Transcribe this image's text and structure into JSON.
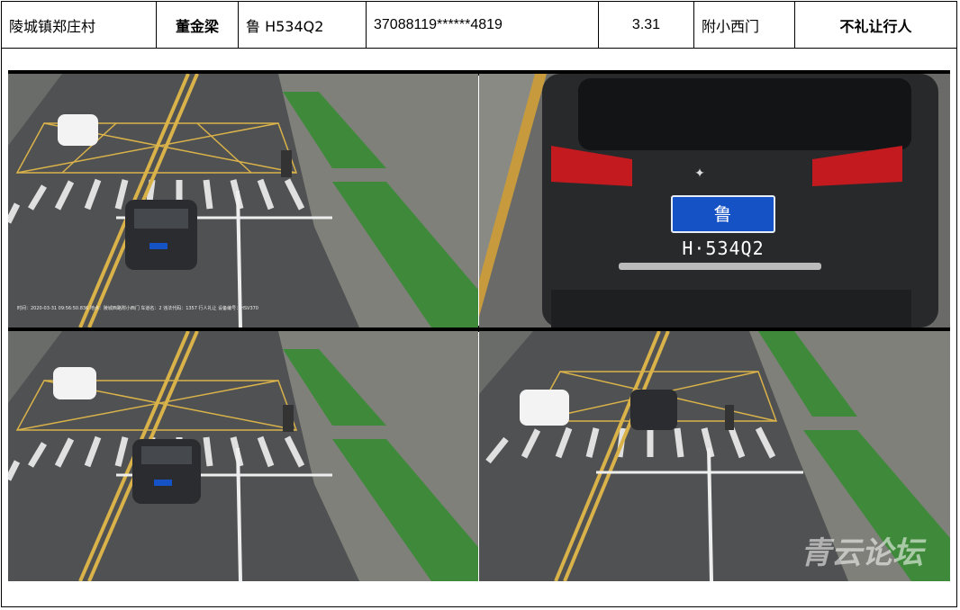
{
  "header": {
    "place": "陵城镇郑庄村",
    "name": "董金梁",
    "plate": "鲁 H534Q2",
    "id_number": "37088119******4819",
    "date": "3.31",
    "location": "附小西门",
    "violation": "不礼让行人"
  },
  "closeup": {
    "plate": "鲁H·534Q2"
  },
  "watermark": "青云论坛"
}
